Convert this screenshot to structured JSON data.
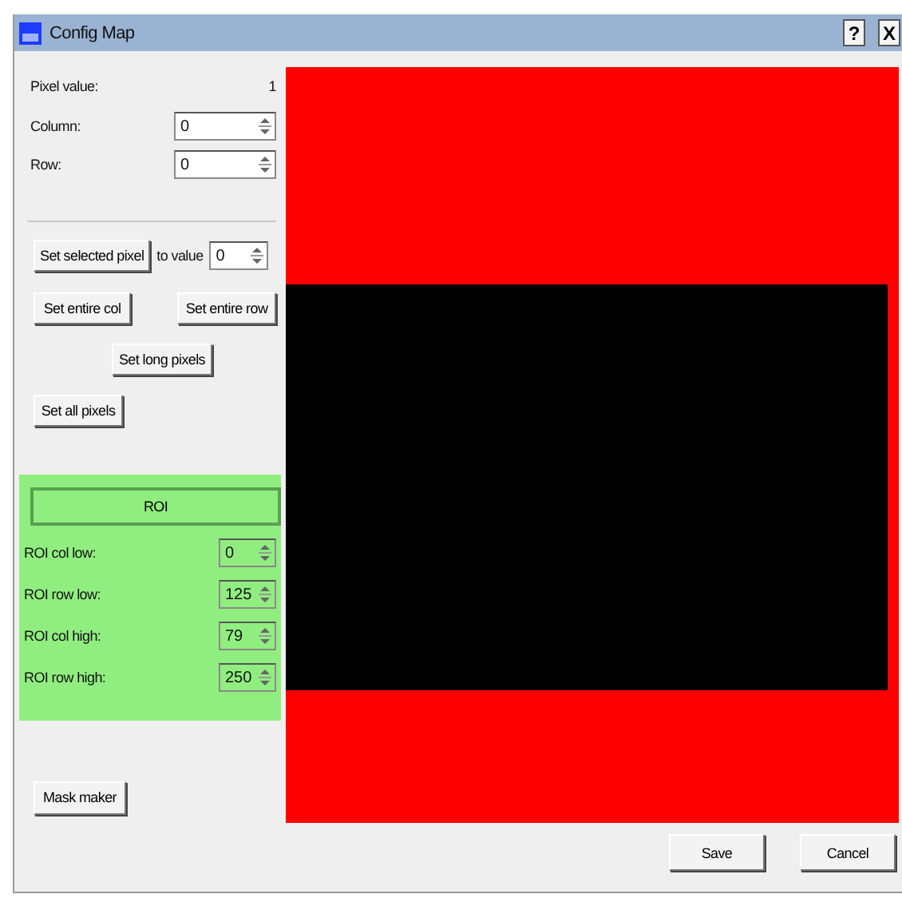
{
  "window": {
    "title": "Config Map",
    "help_button": "?",
    "close_button": "X"
  },
  "pixel": {
    "label": "Pixel value:",
    "value": "1"
  },
  "column": {
    "label": "Column:",
    "value": "0"
  },
  "row": {
    "label": "Row:",
    "value": "0"
  },
  "set_selected": {
    "button": "Set selected pixel",
    "to_label": "to value",
    "value": "0"
  },
  "set_col": "Set entire col",
  "set_row": "Set entire row",
  "set_long": "Set long pixels",
  "set_all": "Set all pixels",
  "roi": {
    "button": "ROI",
    "fields": [
      {
        "label": "ROI col low:",
        "value": "0"
      },
      {
        "label": "ROI row low:",
        "value": "125"
      },
      {
        "label": "ROI col high:",
        "value": "79"
      },
      {
        "label": "ROI row high:",
        "value": "250"
      }
    ]
  },
  "mask_button": "Mask maker",
  "dialog_buttons": [
    "Save",
    "Cancel"
  ]
}
